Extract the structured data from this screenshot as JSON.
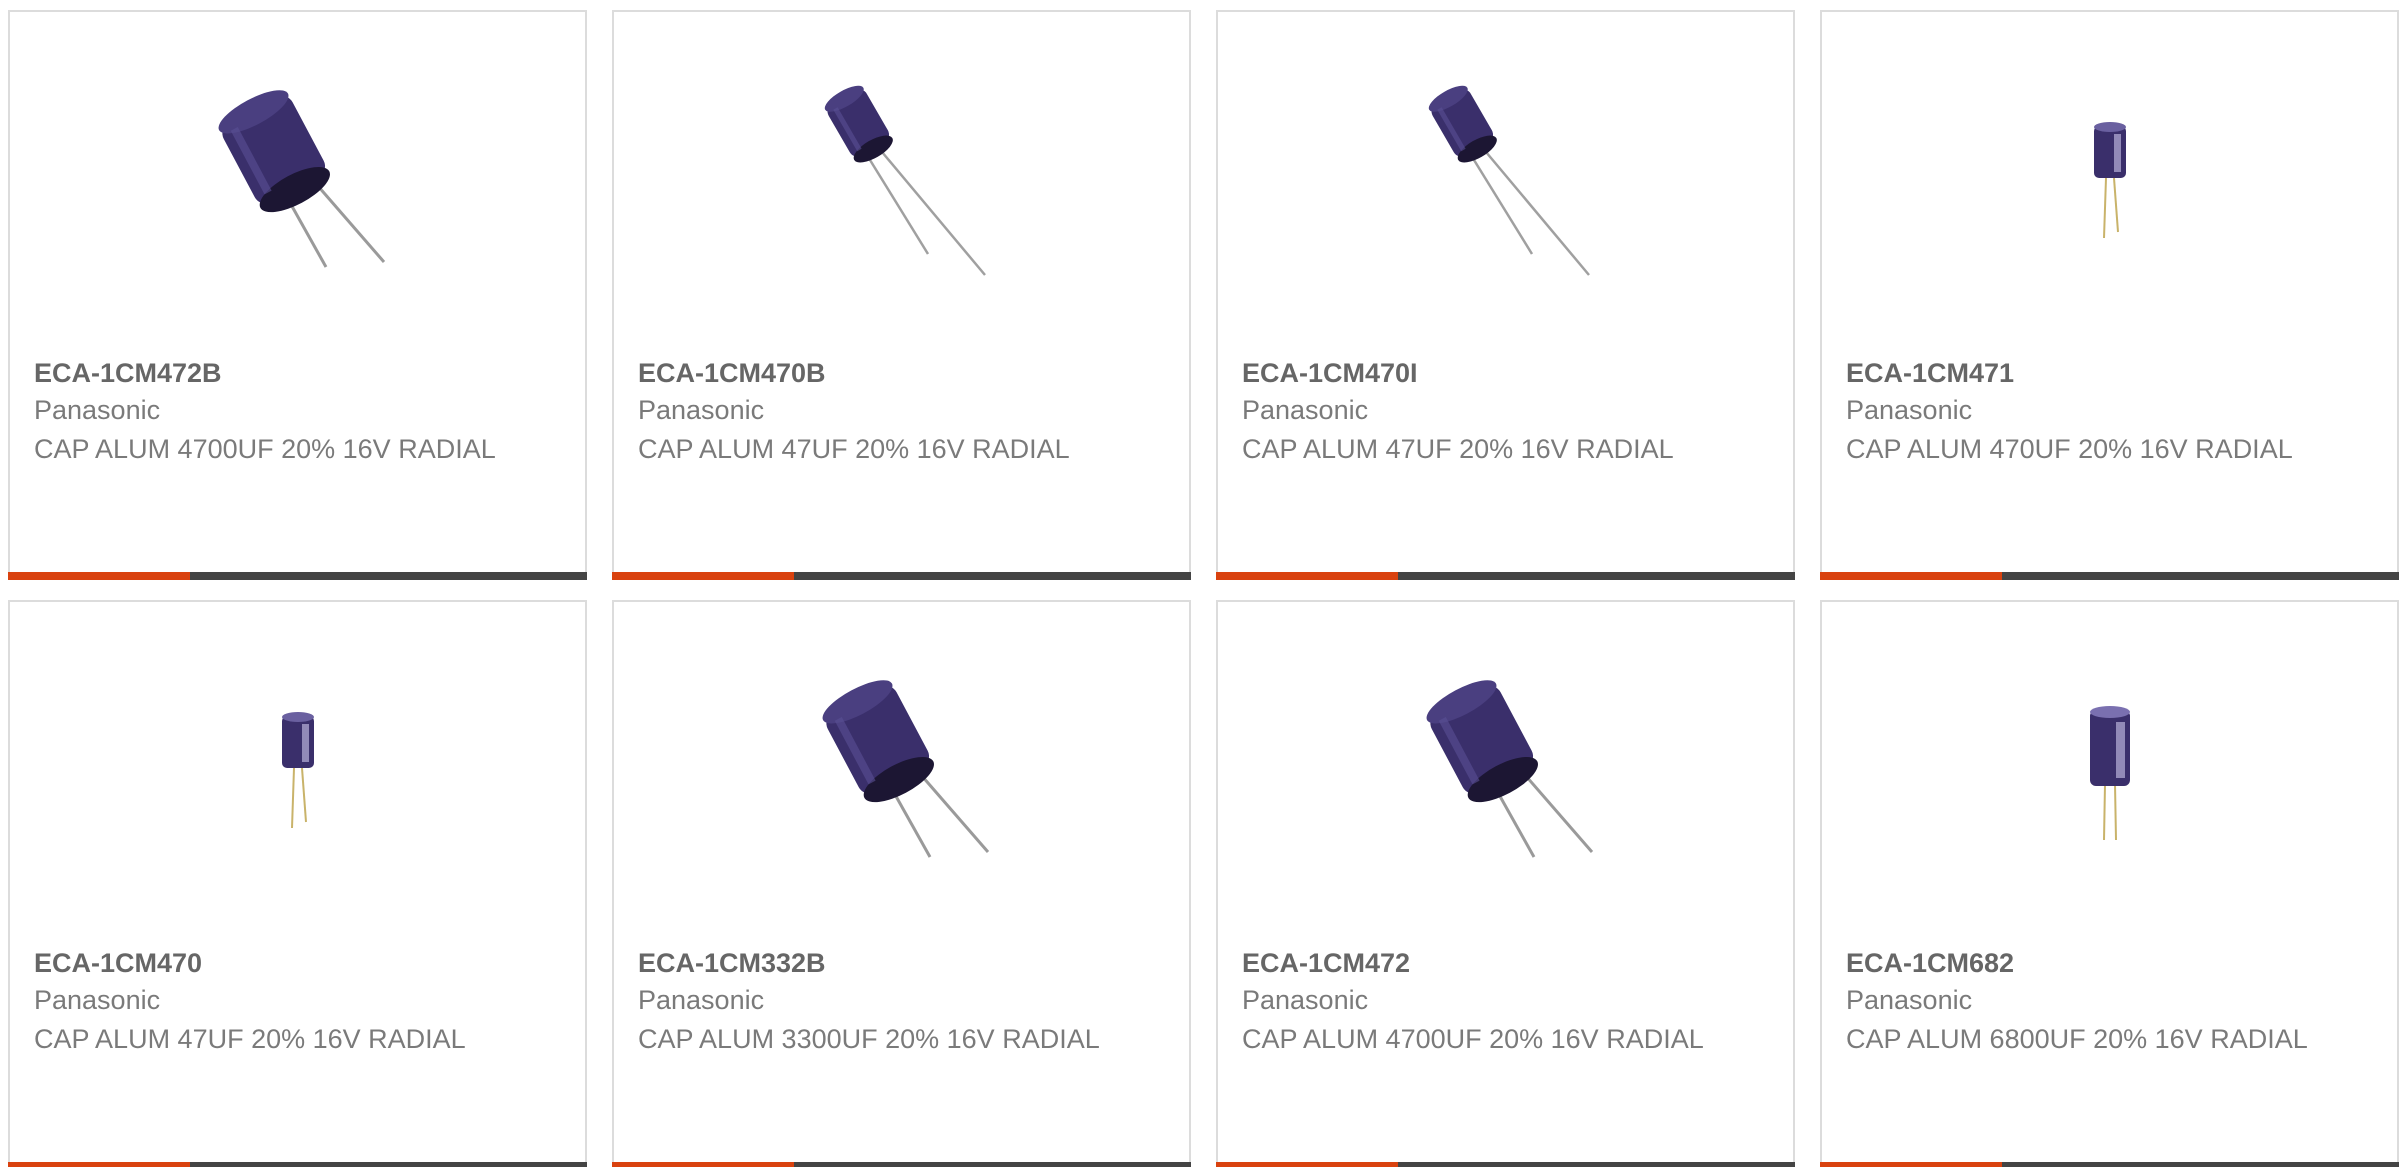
{
  "theme": {
    "accent_color": "#d9420f",
    "bar_color": "#444444",
    "capacitor_color": "#3a2f6b"
  },
  "products": [
    {
      "part": "ECA-1CM472B",
      "manufacturer": "Panasonic",
      "description": "CAP ALUM 4700UF 20% 16V RADIAL",
      "image_icon": "capacitor-large-icon"
    },
    {
      "part": "ECA-1CM470B",
      "manufacturer": "Panasonic",
      "description": "CAP ALUM 47UF 20% 16V RADIAL",
      "image_icon": "capacitor-medium-icon"
    },
    {
      "part": "ECA-1CM470I",
      "manufacturer": "Panasonic",
      "description": "CAP ALUM 47UF 20% 16V RADIAL",
      "image_icon": "capacitor-medium-icon"
    },
    {
      "part": "ECA-1CM471",
      "manufacturer": "Panasonic",
      "description": "CAP ALUM 470UF 20% 16V RADIAL",
      "image_icon": "capacitor-small-upright-icon"
    },
    {
      "part": "ECA-1CM470",
      "manufacturer": "Panasonic",
      "description": "CAP ALUM 47UF 20% 16V RADIAL",
      "image_icon": "capacitor-small-upright-icon"
    },
    {
      "part": "ECA-1CM332B",
      "manufacturer": "Panasonic",
      "description": "CAP ALUM 3300UF 20% 16V RADIAL",
      "image_icon": "capacitor-large-icon"
    },
    {
      "part": "ECA-1CM472",
      "manufacturer": "Panasonic",
      "description": "CAP ALUM 4700UF 20% 16V RADIAL",
      "image_icon": "capacitor-large-icon"
    },
    {
      "part": "ECA-1CM682",
      "manufacturer": "Panasonic",
      "description": "CAP ALUM 6800UF 20% 16V RADIAL",
      "image_icon": "capacitor-upright-icon"
    }
  ]
}
